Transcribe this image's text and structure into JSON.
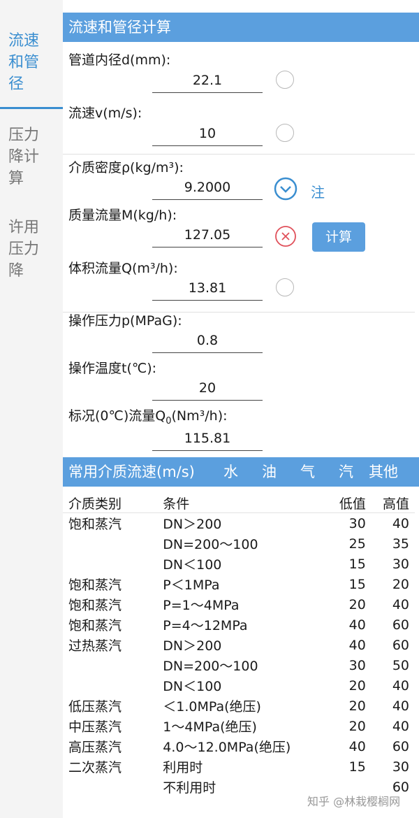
{
  "sidebar": {
    "items": [
      {
        "label": "流速\n和管\n径",
        "active": true
      },
      {
        "label": "压力\n降计\n算",
        "active": false
      },
      {
        "label": "许用\n压力\n降",
        "active": false
      }
    ]
  },
  "calc": {
    "title": "流速和管径计算",
    "fields": [
      {
        "label": "管道内径d(mm):",
        "value": "22.1",
        "control": "radio"
      },
      {
        "label": "流速v(m/s):",
        "value": "10",
        "control": "radio"
      },
      {
        "label": "介质密度ρ(kg/m³):",
        "value": "9.2000",
        "control": "chevron-down-icon"
      },
      {
        "label": "质量流量M(kg/h):",
        "value": "127.05",
        "control": "clear-icon"
      },
      {
        "label": "体积流量Q(m³/h):",
        "value": "13.81",
        "control": "radio"
      },
      {
        "label": "操作压力p(MPaG):",
        "value": "0.8"
      },
      {
        "label": "操作温度t(℃):",
        "value": "20"
      },
      {
        "label_prefix": "标况(0℃)流量Q",
        "label_sub": "0",
        "label_suffix": "(Nm³/h):",
        "value": "115.81"
      }
    ],
    "note_label": "注",
    "calc_button": "计算"
  },
  "media": {
    "title": "常用介质流速(m/s)",
    "tabs": [
      "水",
      "油",
      "气",
      "汽",
      "其他"
    ],
    "headers": [
      "介质类别",
      "条件",
      "低值",
      "高值"
    ],
    "rows": [
      [
        "饱和蒸汽",
        "DN＞200",
        "30",
        "40"
      ],
      [
        "",
        "DN=200～100",
        "25",
        "35"
      ],
      [
        "",
        "DN＜100",
        "15",
        "30"
      ],
      [
        "饱和蒸汽",
        "P＜1MPa",
        "15",
        "20"
      ],
      [
        "饱和蒸汽",
        "P=1～4MPa",
        "20",
        "40"
      ],
      [
        "饱和蒸汽",
        "P=4～12MPa",
        "40",
        "60"
      ],
      [
        "过热蒸汽",
        "DN＞200",
        "40",
        "60"
      ],
      [
        "",
        "DN=200～100",
        "30",
        "50"
      ],
      [
        "",
        "DN＜100",
        "20",
        "40"
      ],
      [
        "低压蒸汽",
        "＜1.0MPa(绝压)",
        "20",
        "40"
      ],
      [
        "中压蒸汽",
        "1～4MPa(绝压)",
        "20",
        "40"
      ],
      [
        "高压蒸汽",
        "4.0～12.0MPa(绝压)",
        "40",
        "60"
      ],
      [
        "二次蒸汽",
        "利用时",
        "15",
        "30"
      ],
      [
        "",
        "不利用时",
        "",
        "60"
      ]
    ]
  },
  "watermark": "知乎 @林栽樱榈网",
  "colors": {
    "accent": "#5b9fde",
    "active_text": "#3a8ed0",
    "error": "#e0505a"
  }
}
